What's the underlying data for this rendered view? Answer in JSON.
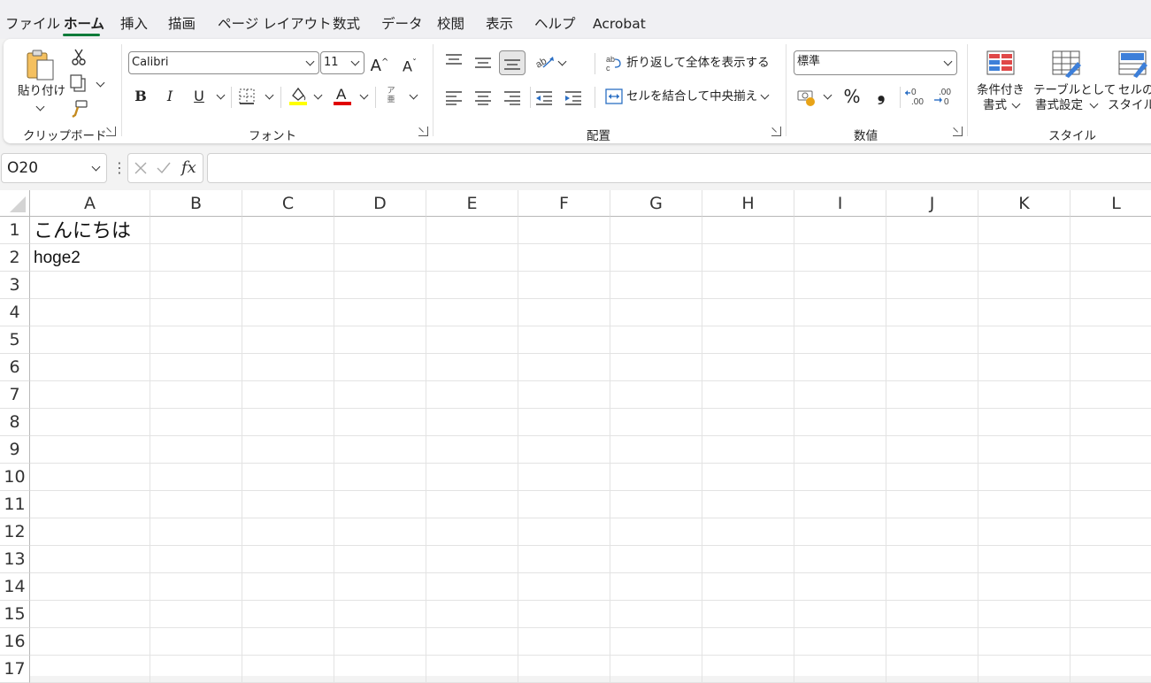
{
  "menu": {
    "tabs": [
      "ファイル",
      "ホーム",
      "挿入",
      "描画",
      "ページ レイアウト",
      "数式",
      "データ",
      "校閲",
      "表示",
      "ヘルプ",
      "Acrobat"
    ],
    "active": "ホーム"
  },
  "ribbon": {
    "clipboard": {
      "paste_label": "貼り付け",
      "group_label": "クリップボード"
    },
    "font": {
      "font_name": "Calibri",
      "font_size": "11",
      "bold": "B",
      "italic": "I",
      "underline": "U",
      "group_label": "フォント",
      "highlight_color": "#ffff00",
      "font_color": "#e00000"
    },
    "alignment": {
      "wrap_text": "折り返して全体を表示する",
      "merge_center": "セルを結合して中央揃え",
      "group_label": "配置"
    },
    "number": {
      "format": "標準",
      "percent": "%",
      "comma": "❟",
      "group_label": "数値"
    },
    "styles": {
      "conditional_line1": "条件付き",
      "conditional_line2": "書式",
      "table_line1": "テーブルとして",
      "table_line2": "書式設定",
      "cell_line1": "セルの",
      "cell_line2": "スタイル",
      "group_label": "スタイル"
    }
  },
  "formula_bar": {
    "name_box": "O20",
    "fx": "fx",
    "formula": ""
  },
  "sheet": {
    "columns": [
      "A",
      "B",
      "C",
      "D",
      "E",
      "F",
      "G",
      "H",
      "I",
      "J",
      "K",
      "L"
    ],
    "rows": [
      "1",
      "2",
      "3",
      "4",
      "5",
      "6",
      "7",
      "8",
      "9",
      "10",
      "11",
      "12",
      "13",
      "14",
      "15",
      "16",
      "17"
    ],
    "cells": {
      "A1": "こんにちは",
      "A2": "hoge2"
    }
  },
  "colors": {
    "accent": "#0f7b3a"
  }
}
